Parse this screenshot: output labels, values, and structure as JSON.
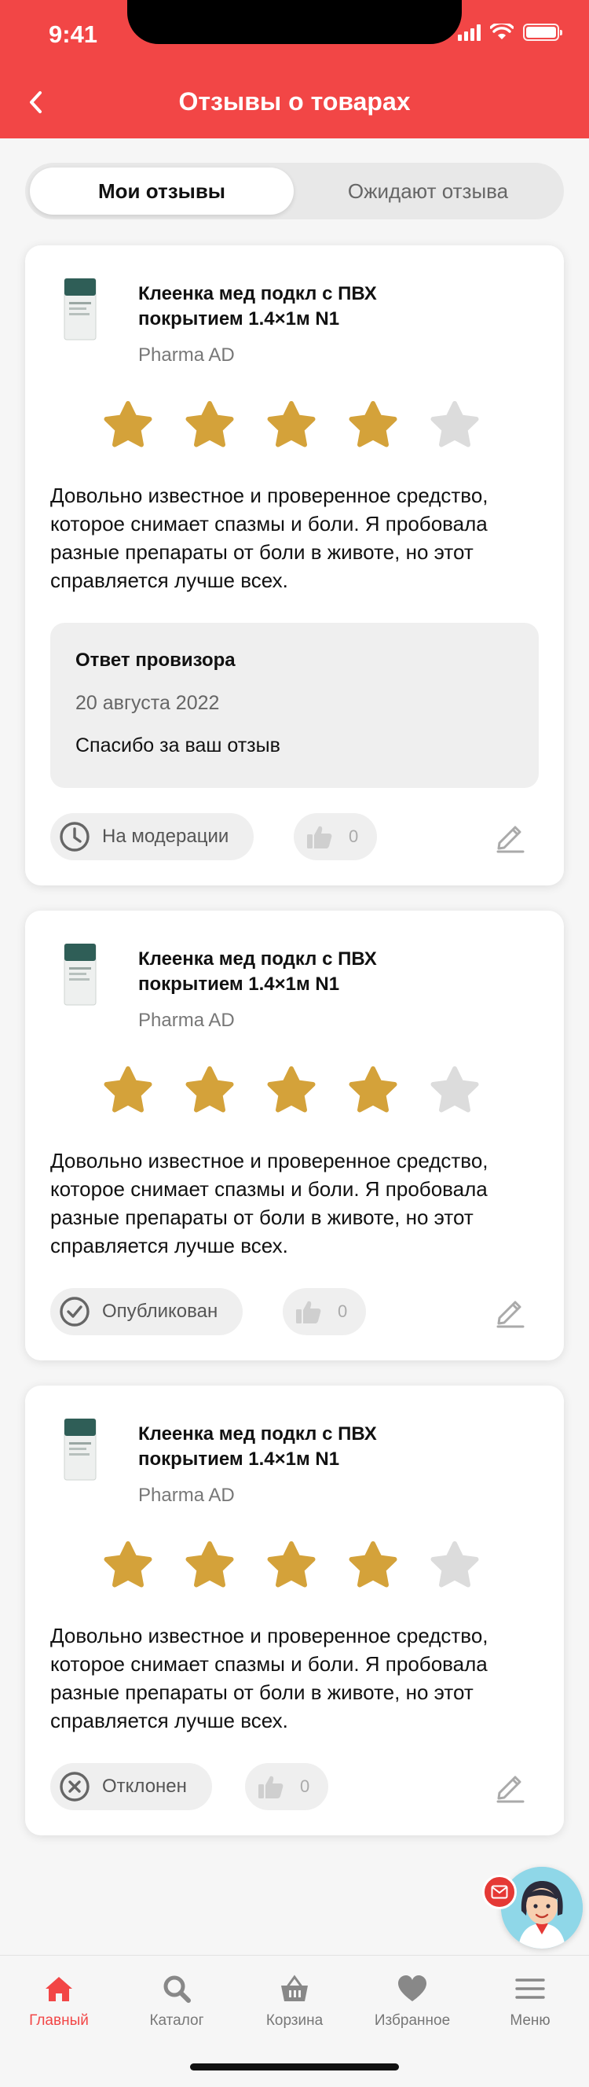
{
  "status_bar": {
    "time": "9:41"
  },
  "header": {
    "title": "Отзывы о товарах"
  },
  "tabs": [
    {
      "label": "Мои отзывы",
      "active": true
    },
    {
      "label": "Ожидают отзыва",
      "active": false
    }
  ],
  "reviews": [
    {
      "product_name": "Клеенка мед подкл с ПВХ покрытием 1.4×1м N1",
      "brand": "Pharma AD",
      "rating": 4,
      "text": "Довольно известное и проверенное средство, которое снимает спазмы и боли. Я пробовала разные препараты от боли в животе, но этот справляется лучше всех.",
      "reply": {
        "title": "Ответ провизора",
        "date": "20 августа 2022",
        "text": "Спасибо за ваш отзыв"
      },
      "status": {
        "label": "На модерации",
        "icon": "clock-icon"
      },
      "likes": "0"
    },
    {
      "product_name": "Клеенка мед подкл с ПВХ покрытием 1.4×1м N1",
      "brand": "Pharma AD",
      "rating": 4,
      "text": "Довольно известное и проверенное средство, которое снимает спазмы и боли. Я пробовала разные препараты от боли в животе, но этот справляется лучше всех.",
      "status": {
        "label": "Опубликован",
        "icon": "check-circle-icon"
      },
      "likes": "0"
    },
    {
      "product_name": "Клеенка мед подкл с ПВХ покрытием 1.4×1м N1",
      "brand": "Pharma AD",
      "rating": 4,
      "text": "Довольно известное и проверенное средство, которое снимает спазмы и боли. Я пробовала разные препараты от боли в животе, но этот справляется лучше всех.",
      "status": {
        "label": "Отклонен",
        "icon": "x-circle-icon"
      },
      "likes": "0"
    }
  ],
  "tabbar": [
    {
      "label": "Главный",
      "icon": "home-icon",
      "active": true
    },
    {
      "label": "Каталог",
      "icon": "search-icon",
      "active": false
    },
    {
      "label": "Корзина",
      "icon": "basket-icon",
      "active": false
    },
    {
      "label": "Избранное",
      "icon": "heart-icon",
      "active": false
    },
    {
      "label": "Меню",
      "icon": "menu-icon",
      "active": false
    }
  ],
  "colors": {
    "accent": "#f24646",
    "star_filled": "#d4a23a",
    "star_empty": "#dcdcdc"
  }
}
